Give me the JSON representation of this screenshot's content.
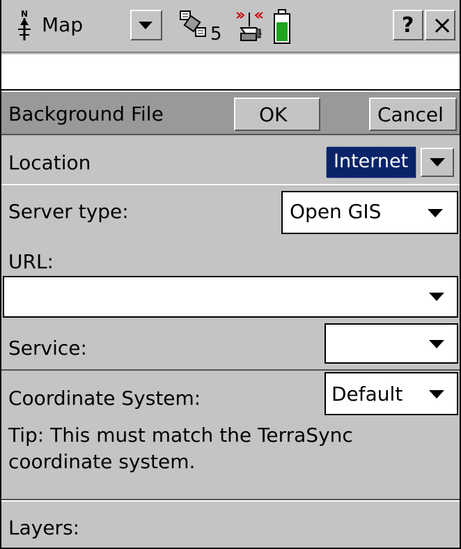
{
  "toolbar": {
    "section_label": "Map",
    "north_icon": "north-arrow-icon",
    "satellite_count": "5",
    "help_label": "?",
    "close_label": "×"
  },
  "status_bar": {
    "text": ""
  },
  "form_header": {
    "title": "Background File",
    "ok_label": "OK",
    "cancel_label": "Cancel"
  },
  "form": {
    "location": {
      "label": "Location",
      "value": "Internet"
    },
    "server_type": {
      "label": "Server type:",
      "value": "Open GIS"
    },
    "url": {
      "label": "URL:",
      "value": ""
    },
    "service": {
      "label": "Service:",
      "value": ""
    },
    "coordinate_system": {
      "label": "Coordinate System:",
      "value": "Default"
    },
    "tip": "Tip: This must match the TerraSync coordinate system.",
    "layers": {
      "label": "Layers:"
    }
  },
  "colors": {
    "selection_bg": "#0a246a",
    "battery_green": "#1fa41f",
    "signal_red": "#cc0000"
  }
}
